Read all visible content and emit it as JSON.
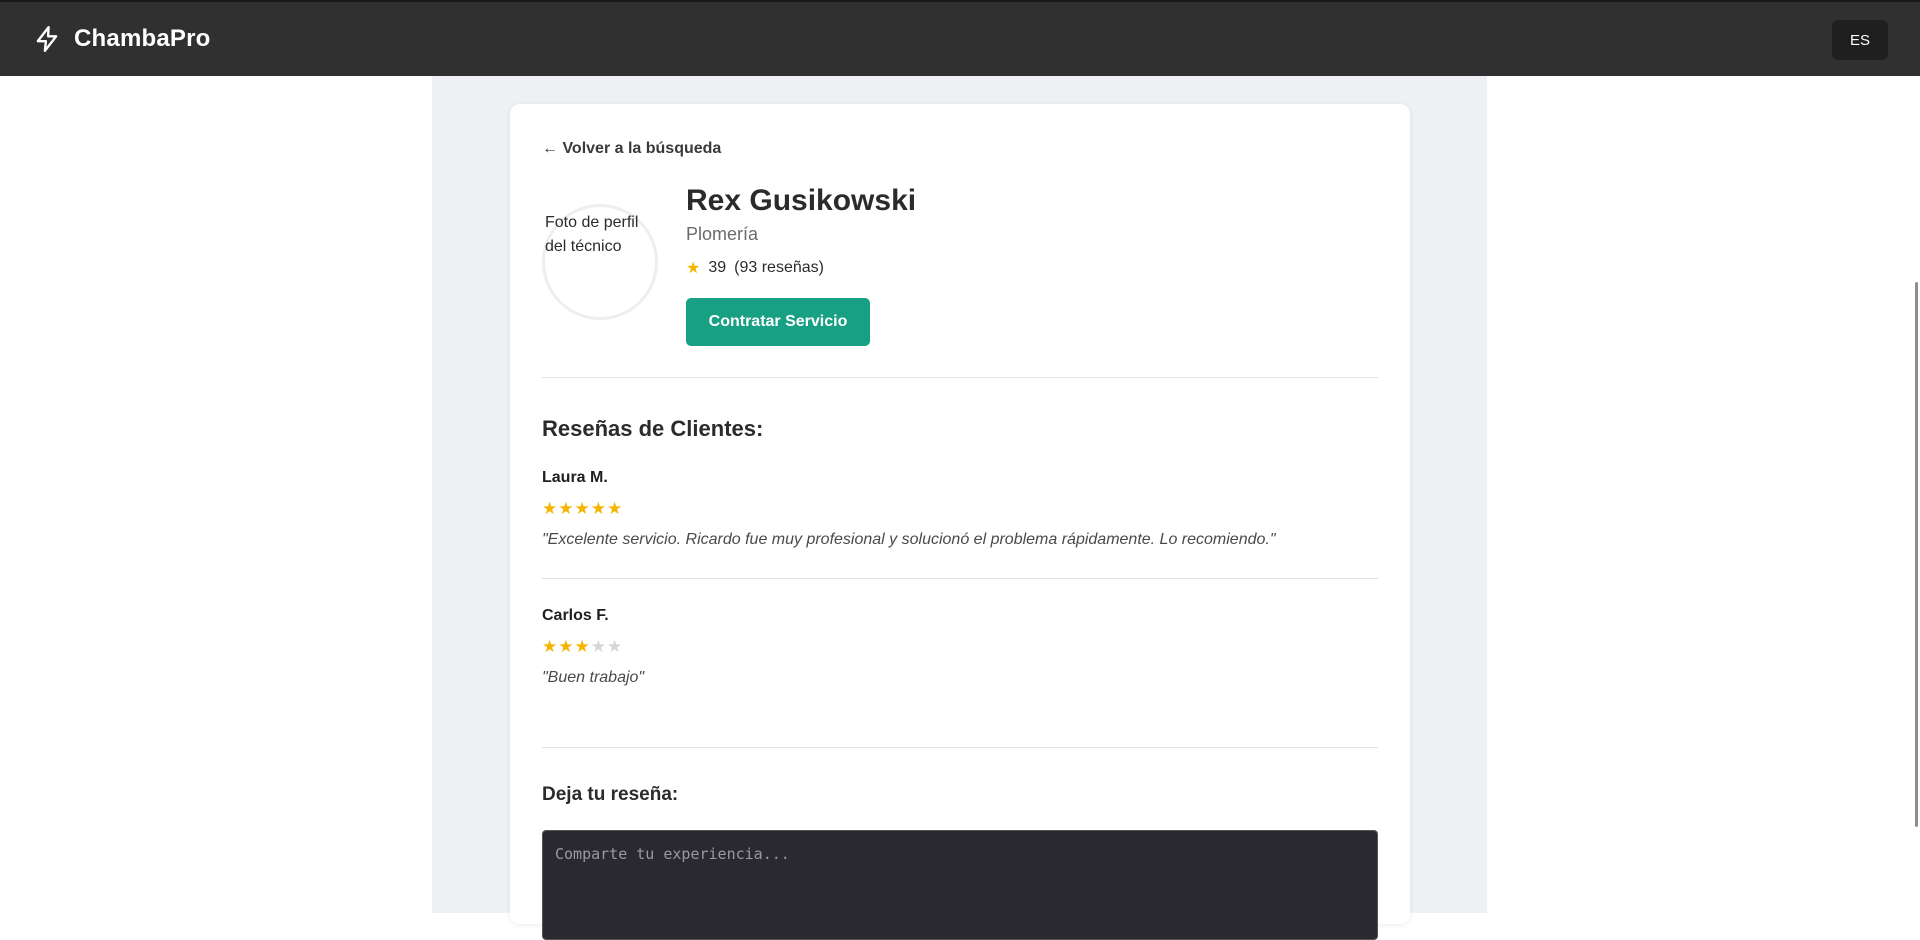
{
  "app": {
    "name": "ChambaPro",
    "icon": "lightning-bolt-icon",
    "language": "ES"
  },
  "profile": {
    "back_label": "← Volver a la búsqueda",
    "avatar_alt": "Foto de perfil del técnico",
    "name": "Rex Gusikowski",
    "trade": "Plomería",
    "rating_value": "39",
    "reviews_count_label": "(93 reseñas)",
    "hire_label": "Contratar Servicio"
  },
  "reviews": {
    "title": "Reseñas de Clientes:",
    "items": [
      {
        "author": "Laura M.",
        "stars": 5,
        "text": "\"Excelente servicio. Ricardo fue muy profesional y solucionó el problema rápidamente. Lo recomiendo.\""
      },
      {
        "author": "Carlos F.",
        "stars": 3,
        "text": "\"Buen trabajo\""
      }
    ]
  },
  "leave_review": {
    "title": "Deja tu reseña:",
    "placeholder": "Comparte tu experiencia..."
  },
  "colors": {
    "topbar": "#303030",
    "accent": "#18a085",
    "star": "#f4b400",
    "star_empty": "#d6d6d6"
  }
}
